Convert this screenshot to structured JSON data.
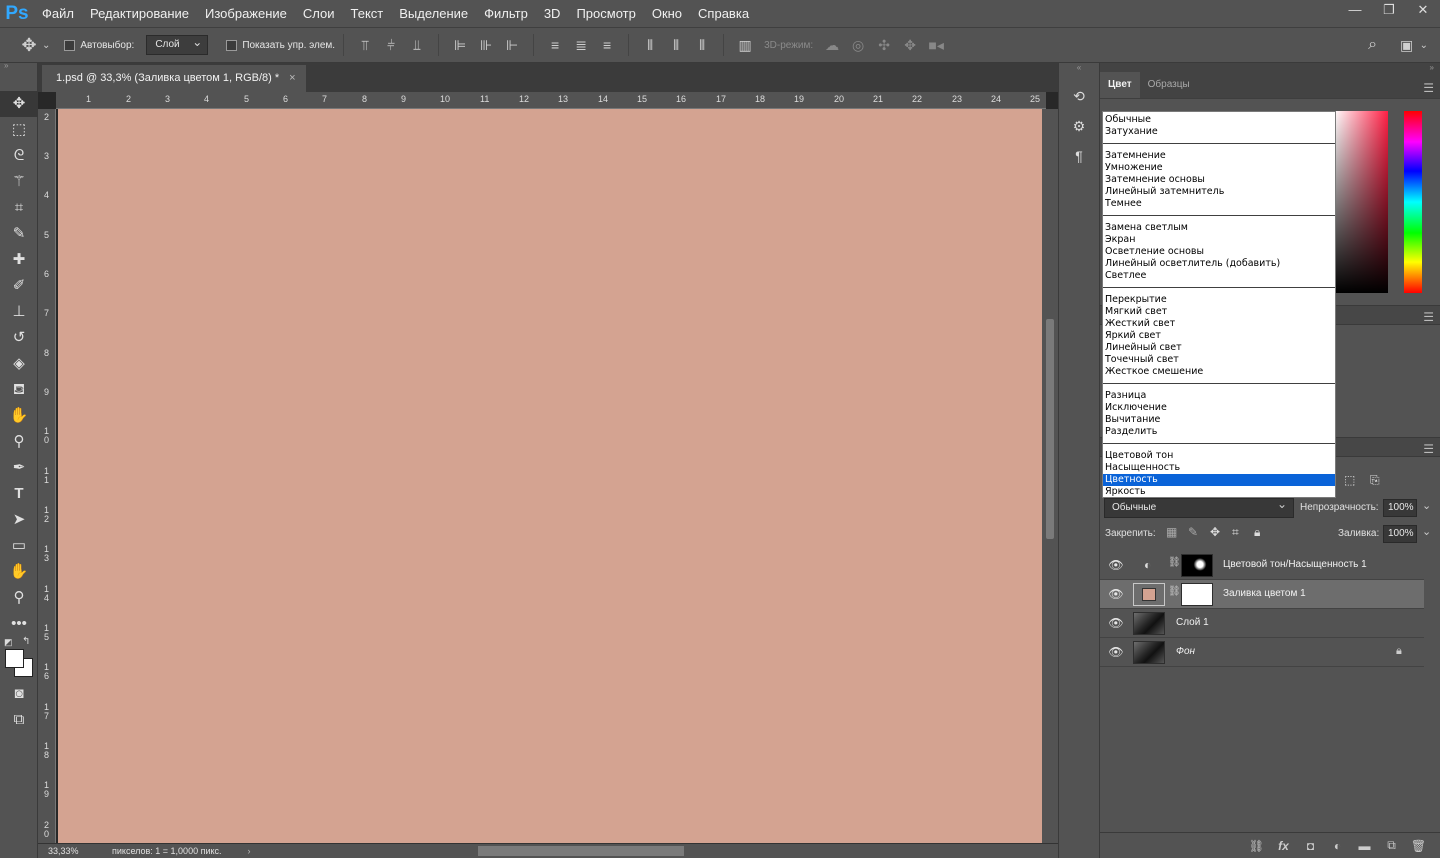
{
  "app": {
    "logo": "Ps"
  },
  "menu": [
    "Файл",
    "Редактирование",
    "Изображение",
    "Слои",
    "Текст",
    "Выделение",
    "Фильтр",
    "3D",
    "Просмотр",
    "Окно",
    "Справка"
  ],
  "window_controls": {
    "minimize": "—",
    "restore": "❐",
    "close": "✕"
  },
  "options": {
    "autoselect_label": "Автовыбор:",
    "autoselect_target": "Слой",
    "show_transform_label": "Показать упр. элем.",
    "mode3d_label": "3D-режим:"
  },
  "document": {
    "tab_title": "1.psd @ 33,3% (Заливка цветом 1, RGB/8) *",
    "tab_close": "×",
    "fill_color": "#d4a391",
    "ruler_top": [
      "1",
      "2",
      "3",
      "4",
      "5",
      "6",
      "7",
      "8",
      "9",
      "10",
      "11",
      "12",
      "13",
      "14",
      "15",
      "16",
      "17",
      "18",
      "19",
      "20",
      "21",
      "22",
      "23",
      "24",
      "25"
    ],
    "ruler_left": [
      "2",
      "3",
      "4",
      "5",
      "6",
      "7",
      "8",
      "9",
      "1 0",
      "1 1",
      "1 2",
      "1 3",
      "1 4",
      "1 5",
      "1 6",
      "1 7",
      "1 8",
      "1 9",
      "2 0"
    ],
    "zoom": "33,33%",
    "status": "пикселов: 1 = 1,0000 пикс."
  },
  "color_panel": {
    "tabs": [
      "Цвет",
      "Образцы"
    ]
  },
  "blend_dropdown": {
    "groups": [
      [
        "Обычные",
        "Затухание"
      ],
      [
        "Затемнение",
        "Умножение",
        "Затемнение основы",
        "Линейный затемнитель",
        "Темнее"
      ],
      [
        "Замена светлым",
        "Экран",
        "Осветление основы",
        "Линейный осветлитель (добавить)",
        "Светлее"
      ],
      [
        "Перекрытие",
        "Мягкий свет",
        "Жесткий свет",
        "Яркий свет",
        "Линейный свет",
        "Точечный свет",
        "Жесткое смешение"
      ],
      [
        "Разница",
        "Исключение",
        "Вычитание",
        "Разделить"
      ],
      [
        "Цветовой тон",
        "Насыщенность",
        "Цветность",
        "Яркость"
      ]
    ],
    "highlighted": "Цветность"
  },
  "layers_panel": {
    "blend_mode": "Обычные",
    "opacity_label": "Непрозрачность:",
    "opacity": "100%",
    "lock_label": "Закрепить:",
    "fill_label": "Заливка:",
    "fill": "100%",
    "layers": [
      {
        "name": "Цветовой тон/Насыщенность 1",
        "kind": "adjustment",
        "selected": false
      },
      {
        "name": "Заливка цветом 1",
        "kind": "fill",
        "selected": true
      },
      {
        "name": "Слой 1",
        "kind": "pixel",
        "selected": false
      },
      {
        "name": "Фон",
        "kind": "background",
        "selected": false
      }
    ]
  }
}
